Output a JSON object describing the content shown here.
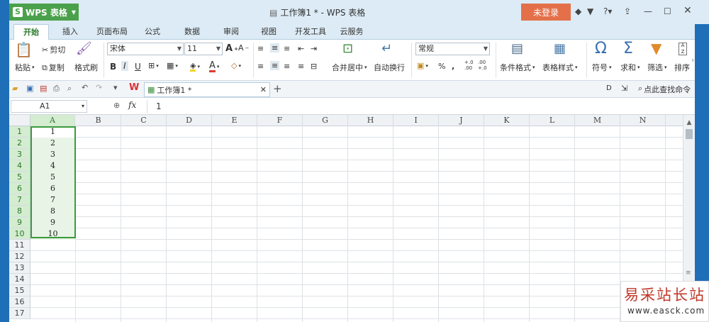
{
  "app": {
    "name": "WPS 表格",
    "title": "工作簿1 * - WPS 表格",
    "login": "未登录"
  },
  "tabs": [
    "开始",
    "插入",
    "页面布局",
    "公式",
    "数据",
    "审阅",
    "视图",
    "开发工具",
    "云服务"
  ],
  "ribbon": {
    "paste": "粘贴",
    "cut": "剪切",
    "copy": "复制",
    "format_painter": "格式刷",
    "font_name": "宋体",
    "font_size": "11",
    "merge": "合并居中",
    "wrap": "自动换行",
    "number_format": "常规",
    "percent": "%",
    "comma": ",",
    "cond_format": "条件格式",
    "table_style": "表格样式",
    "symbol": "符号",
    "sum": "求和",
    "filter": "筛选",
    "sort": "排序",
    "bold": "B",
    "italic": "I",
    "underline": "U",
    "font_color_letter": "A",
    "grow_font": "A",
    "shrink_font": "A",
    "dec_inc": "+.0\n.00",
    "dec_dec": ".00\n+.0"
  },
  "quickbar": {
    "doc_tab": "工作簿1 *",
    "search": "点此查找命令"
  },
  "formula": {
    "namebox": "A1",
    "fx": "fx",
    "value": "1"
  },
  "grid": {
    "columns": [
      "A",
      "B",
      "C",
      "D",
      "E",
      "F",
      "G",
      "H",
      "I",
      "J",
      "K",
      "L",
      "M",
      "N"
    ],
    "rows": [
      "1",
      "2",
      "3",
      "4",
      "5",
      "6",
      "7",
      "8",
      "9",
      "10",
      "11",
      "12",
      "13",
      "14",
      "15",
      "16",
      "17"
    ],
    "colA_values": [
      "1",
      "2",
      "3",
      "4",
      "5",
      "6",
      "7",
      "8",
      "9",
      "10"
    ]
  },
  "watermark": {
    "title": "易采站长站",
    "url": "www.easck.com"
  }
}
